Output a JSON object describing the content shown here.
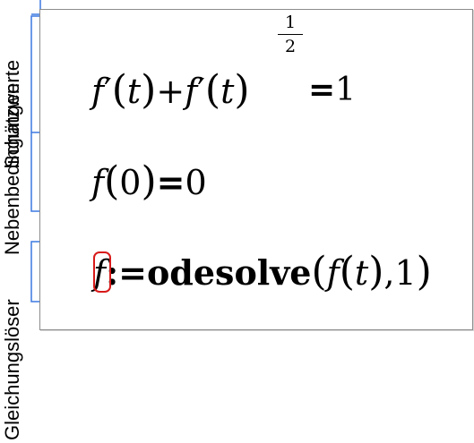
{
  "labels": {
    "solve_block": "Gleichungslöser",
    "constraints": "Nebenbedingungen",
    "guess": "Schätzwerte"
  },
  "equations": {
    "eq1": {
      "f1": "f",
      "prime1": "′",
      "t1": "t",
      "plus": "+",
      "f2": "f",
      "prime2": "′",
      "t2": "t",
      "exp_num": "1",
      "exp_den": "2",
      "equals": "=",
      "rhs": "1"
    },
    "eq2": {
      "f": "f",
      "arg": "0",
      "equals": "=",
      "rhs": "0"
    },
    "eq3": {
      "f": "f",
      "assign": ":=",
      "func": "odesolve",
      "f_inner": "f",
      "t": "t",
      "comma": ",",
      "end": "1"
    }
  },
  "colors": {
    "bracket": "#3c78e0",
    "cursor": "#d81a1a",
    "region_border": "#8c8c8c"
  }
}
